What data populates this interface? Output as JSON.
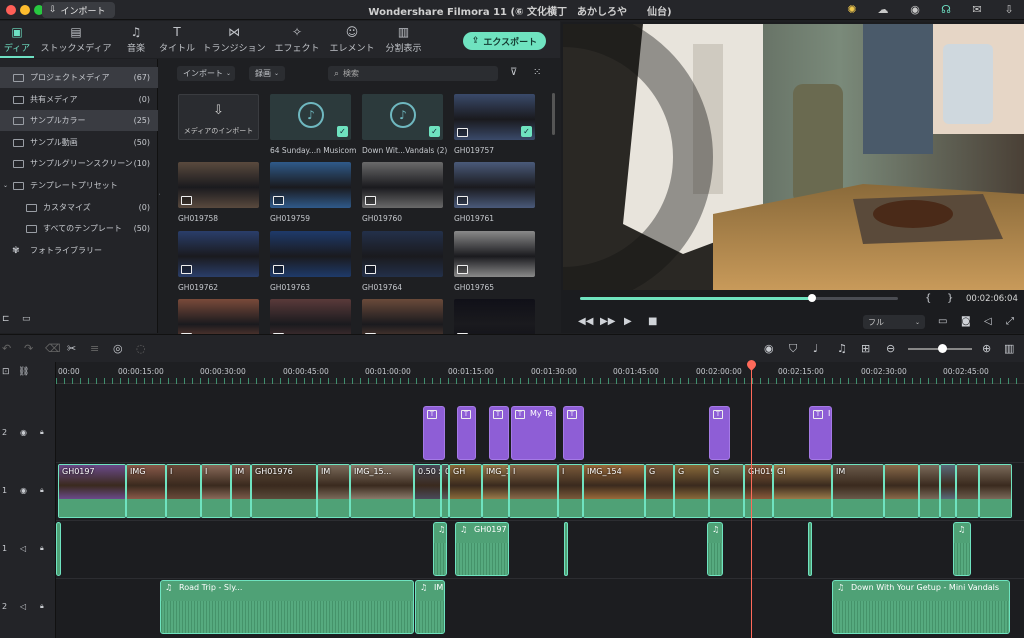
{
  "titlebar": {
    "import_label": "インポート",
    "app_title": "Wondershare Filmora 11 (⑥ 文化横丁　あかしろや　　仙台)"
  },
  "media_tabs": [
    {
      "label": "ディア",
      "icon": "media-icon",
      "active": true
    },
    {
      "label": "ストックメディア",
      "icon": "stock-media-icon"
    },
    {
      "label": "音楽",
      "icon": "music-icon"
    },
    {
      "label": "タイトル",
      "icon": "title-icon"
    },
    {
      "label": "トランジション",
      "icon": "transition-icon"
    },
    {
      "label": "エフェクト",
      "icon": "effect-icon"
    },
    {
      "label": "エレメント",
      "icon": "element-icon"
    },
    {
      "label": "分割表示",
      "icon": "split-screen-icon"
    }
  ],
  "export_label": "エクスポート",
  "sidebar": {
    "items": [
      {
        "label": "プロジェクトメディア",
        "count": "(67)",
        "indent": 0,
        "selected": true,
        "arrow": true
      },
      {
        "label": "共有メディア",
        "count": "(0)",
        "indent": 0
      },
      {
        "label": "サンプルカラー",
        "count": "(25)",
        "indent": 0,
        "selected2": true
      },
      {
        "label": "サンプル動画",
        "count": "(50)",
        "indent": 0
      },
      {
        "label": "サンプルグリーンスクリーン",
        "count": "(10)",
        "indent": 0
      },
      {
        "label": "テンプレートプリセット",
        "count": "",
        "indent": 0,
        "arrow": true
      },
      {
        "label": "カスタマイズ",
        "count": "(0)",
        "indent": 1
      },
      {
        "label": "すべてのテンプレート",
        "count": "(50)",
        "indent": 1
      },
      {
        "label": "フォトライブラリー",
        "count": "",
        "indent": 0,
        "photo": true
      }
    ]
  },
  "browser": {
    "import_dropdown": "インポート",
    "record_dropdown": "録画",
    "search_placeholder": "検索",
    "import_tile_label": "メディアのインポート",
    "items": [
      {
        "name": "64 Sunday...n Musicom",
        "kind": "audio",
        "checked": true
      },
      {
        "name": "Down Wit...Vandals (2)",
        "kind": "audio",
        "checked": true
      },
      {
        "name": "GH019757",
        "kind": "video",
        "checked": true,
        "color": "#3a4a6a"
      },
      {
        "name": "GH019758",
        "kind": "video",
        "color": "#5a4a3e"
      },
      {
        "name": "GH019759",
        "kind": "video",
        "color": "#2f5a8a"
      },
      {
        "name": "GH019760",
        "kind": "video",
        "color": "#6a6a6a"
      },
      {
        "name": "GH019761",
        "kind": "video",
        "color": "#4a5a7a"
      },
      {
        "name": "GH019762",
        "kind": "video",
        "color": "#2a3e6a"
      },
      {
        "name": "GH019763",
        "kind": "video",
        "color": "#1e3a6a"
      },
      {
        "name": "GH019764",
        "kind": "video",
        "color": "#23304a"
      },
      {
        "name": "GH019765",
        "kind": "video",
        "color": "#8a8a8a"
      },
      {
        "name": "",
        "kind": "video",
        "color": "#7a4a3a"
      },
      {
        "name": "",
        "kind": "video",
        "color": "#5a3a3a"
      },
      {
        "name": "",
        "kind": "video",
        "color": "#6a4a3a"
      },
      {
        "name": "",
        "kind": "video",
        "color": "#101018"
      }
    ]
  },
  "preview": {
    "timecode": "00:02:06:04",
    "quality": "フル",
    "progress": 0.73
  },
  "timeline": {
    "ruler": [
      "00:00",
      "00:00:15:00",
      "00:00:30:00",
      "00:00:45:00",
      "00:01:00:00",
      "00:01:15:00",
      "00:01:30:00",
      "00:01:45:00",
      "00:02:00:00",
      "00:02:15:00",
      "00:02:30:00",
      "00:02:45:00"
    ],
    "track_numbers": {
      "title_track": "2",
      "video_track": "1",
      "audio_track_1": "1",
      "audio_track_2": "2"
    },
    "title_clips": [
      {
        "label": ""
      },
      {
        "label": ""
      },
      {
        "label": ""
      },
      {
        "label": "My Te"
      },
      {
        "label": ""
      },
      {
        "label": ""
      },
      {
        "label": "I"
      }
    ],
    "video_clips": [
      {
        "label": "GH0197"
      },
      {
        "label": "IMG"
      },
      {
        "label": "I"
      },
      {
        "label": "I"
      },
      {
        "label": "IM"
      },
      {
        "label": "GH01976"
      },
      {
        "label": "IM"
      },
      {
        "label": "IMG_15..."
      },
      {
        "label": "0.50 x"
      },
      {
        "label": "0.3..."
      },
      {
        "label": "GH"
      },
      {
        "label": "IMG_1"
      },
      {
        "label": "I"
      },
      {
        "label": "I"
      },
      {
        "label": "IMG_154"
      },
      {
        "label": "G"
      },
      {
        "label": "G"
      },
      {
        "label": "G"
      },
      {
        "label": "GH0197..."
      },
      {
        "label": "GI"
      },
      {
        "label": "IM"
      }
    ],
    "audio1_clips": [
      {
        "label": ""
      },
      {
        "label": "GH0197"
      },
      {
        "label": ""
      },
      {
        "label": ""
      }
    ],
    "audio2_clips": [
      {
        "label": "Road Trip - Sly..."
      },
      {
        "label": "IM"
      },
      {
        "label": "Down With Your Getup - Mini Vandals"
      }
    ]
  }
}
